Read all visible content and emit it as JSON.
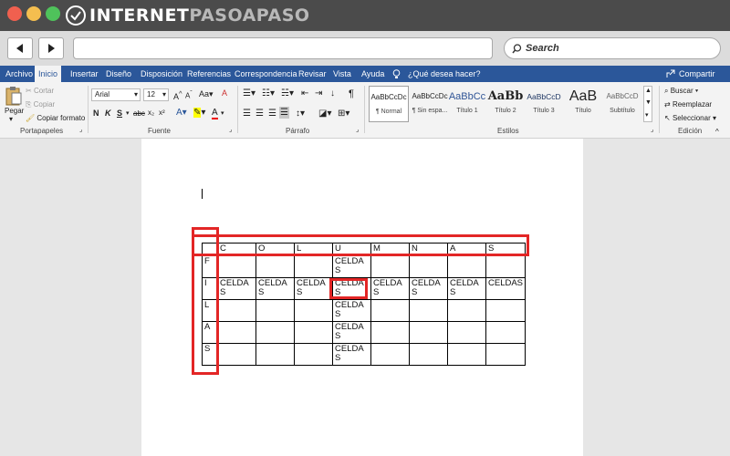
{
  "site": {
    "logo_main": "INTERNET",
    "logo_accent": "PASOAPASO"
  },
  "browser": {
    "search_label": "Search"
  },
  "tabs": [
    "Archivo",
    "Inicio",
    "Insertar",
    "Diseño",
    "Disposición",
    "Referencias",
    "Correspondencia",
    "Revisar",
    "Vista",
    "Ayuda"
  ],
  "tell_me": "¿Qué desea hacer?",
  "share": "Compartir",
  "ribbon": {
    "clipboard": {
      "paste": "Pegar",
      "cut": "Cortar",
      "copy": "Copiar",
      "format_painter": "Copiar formato",
      "label": "Portapapeles"
    },
    "font": {
      "name": "Arial",
      "size": "12",
      "label": "Fuente",
      "bold": "N",
      "italic": "K",
      "underline": "S",
      "strike": "abc"
    },
    "paragraph": {
      "label": "Párrafo"
    },
    "styles": {
      "label": "Estilos",
      "items": [
        {
          "sample": "AaBbCcDc",
          "name": "¶ Normal"
        },
        {
          "sample": "AaBbCcDc",
          "name": "¶ Sin espa..."
        },
        {
          "sample": "AaBbCc",
          "name": "Título 1"
        },
        {
          "sample": "AaBb",
          "name": "Título 2"
        },
        {
          "sample": "AaBbCcD",
          "name": "Título 3"
        },
        {
          "sample": "AaB",
          "name": "Título"
        },
        {
          "sample": "AaBbCcD",
          "name": "Subtítulo"
        }
      ]
    },
    "editing": {
      "find": "Buscar",
      "replace": "Reemplazar",
      "select": "Seleccionar",
      "label": "Edición"
    }
  },
  "table": {
    "header": [
      "",
      "C",
      "O",
      "L",
      "U",
      "M",
      "N",
      "A",
      "S"
    ],
    "rows": [
      [
        "F",
        "",
        "",
        "",
        "CELDAS",
        "",
        "",
        "",
        ""
      ],
      [
        "I",
        "CELDAS",
        "CELDAS",
        "CELDAS",
        "CELDAS",
        "CELDAS",
        "CELDAS",
        "CELDAS",
        "CELDAS"
      ],
      [
        "L",
        "",
        "",
        "",
        "CELDAS",
        "",
        "",
        "",
        ""
      ],
      [
        "A",
        "",
        "",
        "",
        "CELDAS",
        "",
        "",
        "",
        ""
      ],
      [
        "S",
        "",
        "",
        "",
        "CELDAS",
        "",
        "",
        "",
        ""
      ]
    ]
  },
  "highlight_color": "#e32626",
  "ribbon_color": "#2b579a"
}
